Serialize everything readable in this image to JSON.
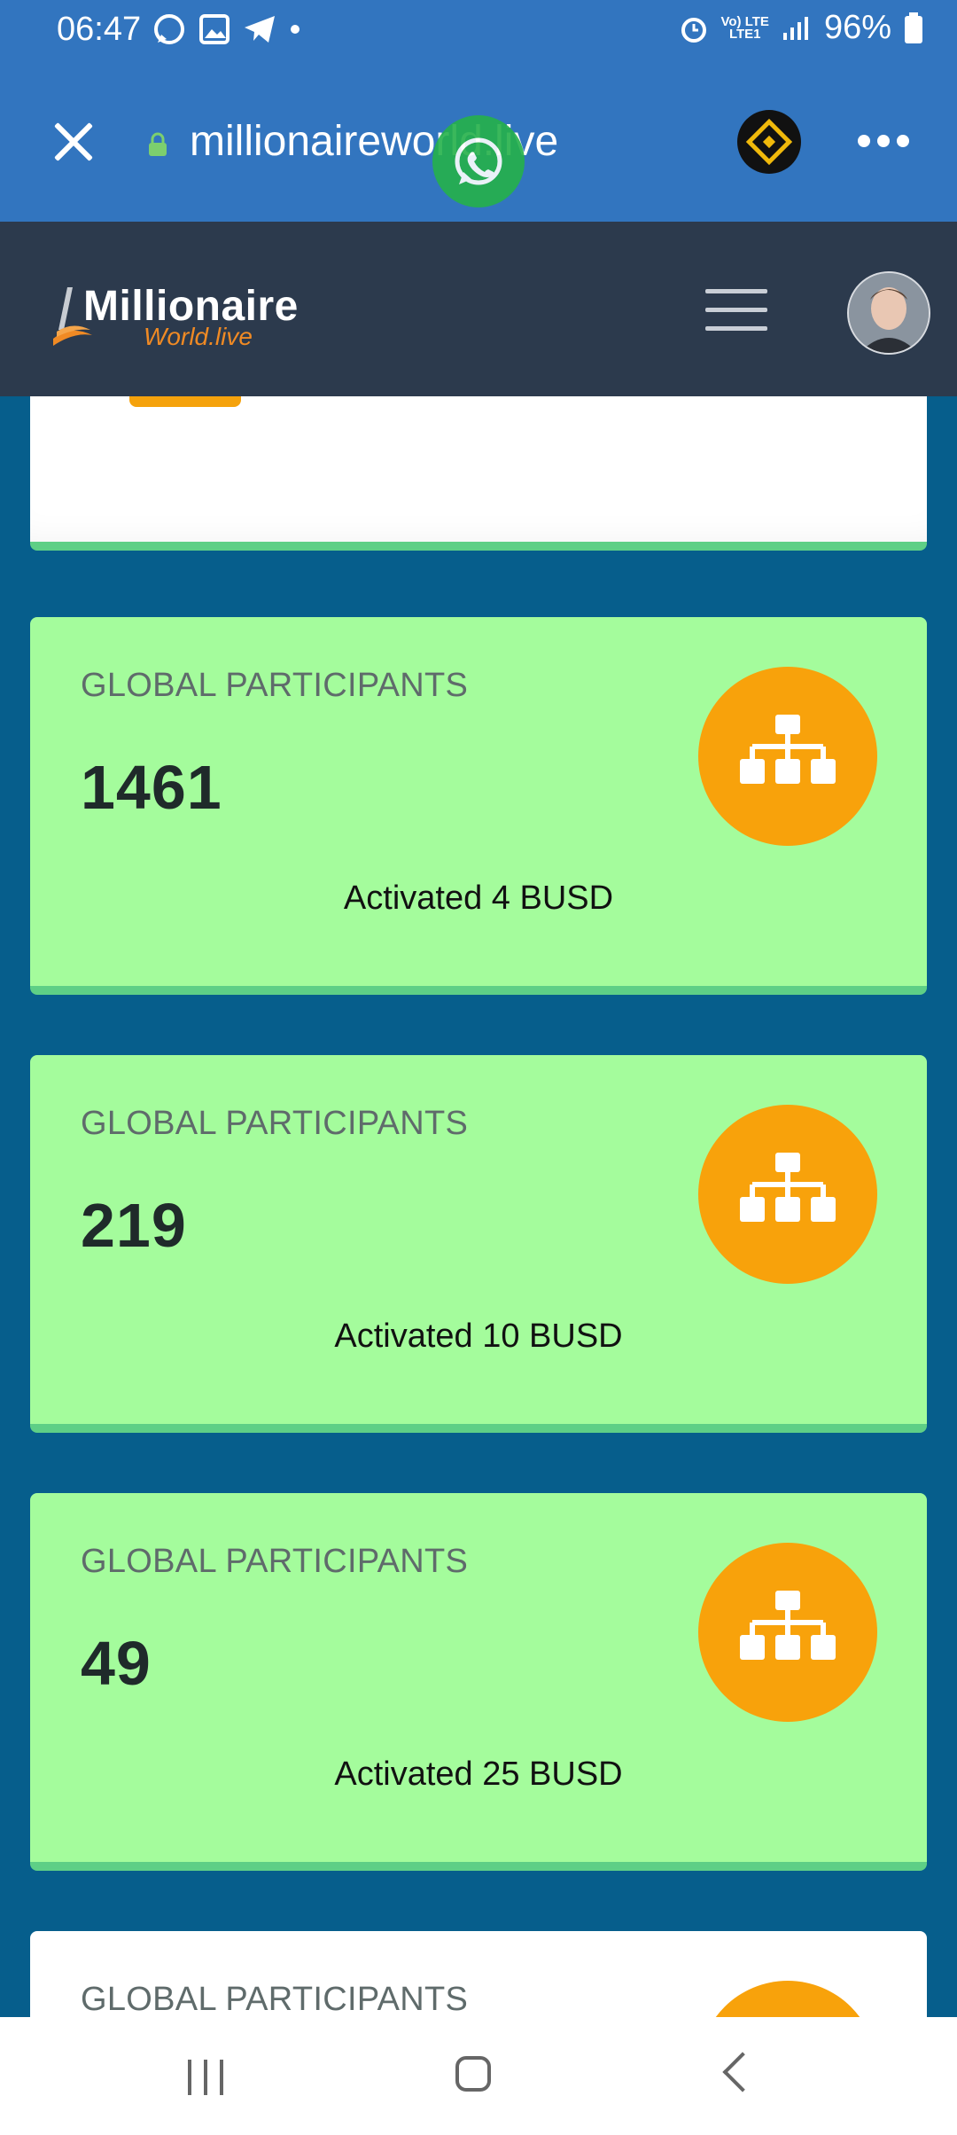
{
  "status_bar": {
    "time": "06:47",
    "network": "Vo) LTE",
    "network_sub": "LTE1",
    "battery": "96%"
  },
  "browser": {
    "url": "millionaireworld.live"
  },
  "site": {
    "logo_main": "Millionaire",
    "logo_sub": "World.live"
  },
  "cards": [
    {
      "label": "GLOBAL PARTICIPANTS",
      "value": "1461",
      "subtitle": "Activated 4 BUSD"
    },
    {
      "label": "GLOBAL PARTICIPANTS",
      "value": "219",
      "subtitle": "Activated 10 BUSD"
    },
    {
      "label": "GLOBAL PARTICIPANTS",
      "value": "49",
      "subtitle": "Activated 25 BUSD"
    },
    {
      "label": "GLOBAL PARTICIPANTS"
    }
  ],
  "colors": {
    "accent": "#f8a20b",
    "card_green": "#a4fc9c",
    "page_bg": "#065e8c",
    "header_bg": "#2c3a4d",
    "browser_bar": "#3275bf"
  }
}
